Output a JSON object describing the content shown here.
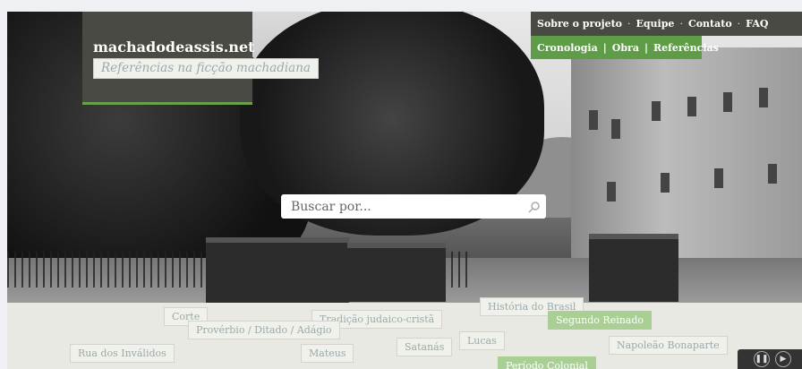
{
  "site": {
    "name": "machadodeassis.net",
    "tagline": "Referências na ficção machadiana"
  },
  "nav_top": [
    "Sobre o projeto",
    "Equipe",
    "Contato",
    "FAQ"
  ],
  "nav_top_separator": "·",
  "nav_sub": [
    "Cronologia",
    "Obra",
    "Referências"
  ],
  "nav_sub_separator": "|",
  "search": {
    "placeholder": "Buscar por..."
  },
  "tags": [
    "Corte",
    "Tradição judaico-cristã",
    "História do Brasil",
    "Segundo Reinado",
    "Provérbio / Ditado / Adágio",
    "Lucas",
    "Satanás",
    "Napoleão Bonaparte",
    "Rua dos Inválidos",
    "Mateus",
    "Período Colonial"
  ],
  "colors": {
    "brand_bg": "#4a4a44",
    "accent_green": "#5f9c48",
    "tag_green": "#a9cf95"
  }
}
